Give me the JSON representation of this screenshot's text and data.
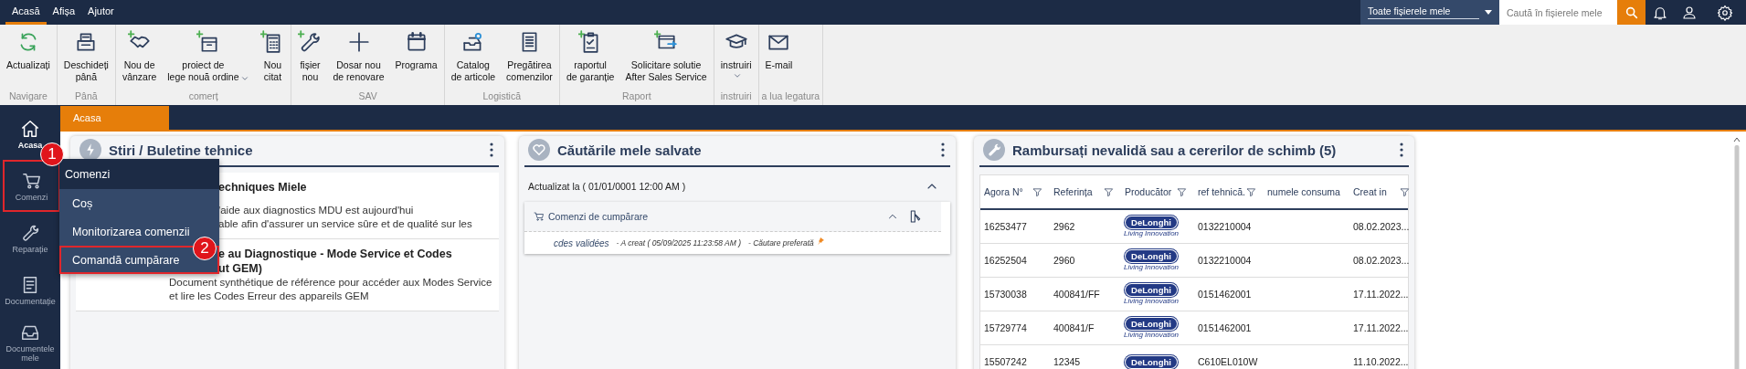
{
  "menu_tabs": [
    {
      "label": "Acasă",
      "selected": true
    },
    {
      "label": "Afișa",
      "selected": false
    },
    {
      "label": "Ajutor",
      "selected": false
    }
  ],
  "scope_dropdown": {
    "value": "Toate fișierele mele"
  },
  "search": {
    "placeholder": "Caută în fișierele mele"
  },
  "ribbon": {
    "groups": [
      {
        "label": "Navigare",
        "buttons": [
          {
            "label": "Actualizați",
            "dropdown": false
          }
        ]
      },
      {
        "label": "Până",
        "buttons": [
          {
            "label": "Deschideți\npână",
            "dropdown": false
          }
        ]
      },
      {
        "label": "comerț",
        "buttons": [
          {
            "label": "Nou de\nvânzare",
            "dropdown": false
          },
          {
            "label": "proiect de\nlege nouă ordine",
            "dropdown": true
          },
          {
            "label": "Nou\ncitat",
            "dropdown": false
          }
        ]
      },
      {
        "label": "SAV",
        "buttons": [
          {
            "label": "fișier\nnou",
            "dropdown": false
          },
          {
            "label": "Dosar nou\nde renovare",
            "dropdown": false
          },
          {
            "label": "Programa",
            "dropdown": false
          }
        ]
      },
      {
        "label": "Logistică",
        "buttons": [
          {
            "label": "Catalog\nde articole",
            "dropdown": false
          },
          {
            "label": "Pregătirea\ncomenzilor",
            "dropdown": false
          }
        ]
      },
      {
        "label": "Raport",
        "buttons": [
          {
            "label": "raportul\nde garanție",
            "dropdown": false
          },
          {
            "label": "Solicitare solutie\nAfter Sales Service",
            "dropdown": false
          }
        ]
      },
      {
        "label": "instruiri",
        "buttons": [
          {
            "label": "instruiri",
            "dropdown": true
          }
        ]
      },
      {
        "label": "a lua legatura",
        "buttons": [
          {
            "label": "E-mail",
            "dropdown": false
          }
        ]
      }
    ]
  },
  "page_tab": {
    "label": "Acasa",
    "selected": true
  },
  "sidebar": {
    "items": [
      {
        "label": "Acasa",
        "selected": true,
        "highlighted": false
      },
      {
        "label": "Comenzi",
        "selected": false,
        "highlighted": true
      },
      {
        "label": "Reparație",
        "selected": false,
        "highlighted": false
      },
      {
        "label": "Documentație",
        "selected": false,
        "highlighted": false
      },
      {
        "label": "Documentele\nmele",
        "selected": false,
        "highlighted": false
      }
    ]
  },
  "flyout_menu": {
    "title": "Comenzi",
    "items": [
      {
        "label": "Coș",
        "highlighted": false
      },
      {
        "label": "Monitorizarea comenzii",
        "highlighted": false
      },
      {
        "label": "Comandă cumpărare",
        "highlighted": true
      }
    ]
  },
  "annotations": [
    "1",
    "2"
  ],
  "cards": [
    {
      "kind": "news",
      "title": "Stiri / Buletine tehnice",
      "items": [
        {
          "title_lines": [
            "echniques Miele"
          ],
          "text_lines": [
            "'aide aux diagnostics MDU est aujourd'hui",
            "able afin d'assurer un service sûre et de qualité sur les"
          ],
          "cut": true
        },
        {
          "title_lines": [
            "e au Diagnostique - Mode Service et Codes",
            "ut GEM)"
          ],
          "text_lines": [
            "Document synthétique de référence pour accéder aux Modes Service",
            "et lire les Codes Erreur des appareils GEM"
          ],
          "cut": false
        }
      ]
    },
    {
      "kind": "saved_searches",
      "title": "Căutările mele salvate",
      "updated": "Actualizat la ( 01/01/0001 12:00 AM )",
      "expanded": true,
      "groups": [
        {
          "title": "Comenzi de cumpărare",
          "expanded": true,
          "searches": [
            {
              "name": "cdes validées",
              "created": "-  A creat ( 05/09/2025 11:23:58 AM )",
              "favorite": "-  Căutare preferată",
              "pinned": true
            }
          ]
        }
      ]
    },
    {
      "kind": "table",
      "title": "Rambursați nevalidă sau a cererilor de schimb (5)",
      "columns": [
        {
          "label": "Agora N°",
          "filter": true
        },
        {
          "label": "Referința",
          "filter": true
        },
        {
          "label": "Producător",
          "filter": true
        },
        {
          "label": "ref tehnică.",
          "filter": true
        },
        {
          "label": "numele consuma",
          "filter": false
        },
        {
          "label": "Creat in",
          "filter": true
        }
      ],
      "rows": [
        {
          "agora": "16253477",
          "reference": "2962",
          "producer": {
            "logo": "DeLonghi",
            "tagline": "Living Innovation"
          },
          "tech_ref": "0132210004",
          "created": "08.02.2023..."
        },
        {
          "agora": "16252504",
          "reference": "2960",
          "producer": {
            "logo": "DeLonghi",
            "tagline": "Living Innovation"
          },
          "tech_ref": "0132210004",
          "created": "08.02.2023..."
        },
        {
          "agora": "15730038",
          "reference": "400841/FF",
          "producer": {
            "logo": "DeLonghi",
            "tagline": "Living Innovation"
          },
          "tech_ref": "0151462001",
          "created": "17.11.2022..."
        },
        {
          "agora": "15729774",
          "reference": "400841/F",
          "producer": {
            "logo": "DeLonghi",
            "tagline": "Living Innovation"
          },
          "tech_ref": "0151462001",
          "created": "17.11.2022..."
        },
        {
          "agora": "15507242",
          "reference": "12345",
          "producer": {
            "logo": "DeLonghi"
          },
          "tech_ref": "C610EL010W",
          "created": "11.10.2022..."
        }
      ]
    }
  ]
}
